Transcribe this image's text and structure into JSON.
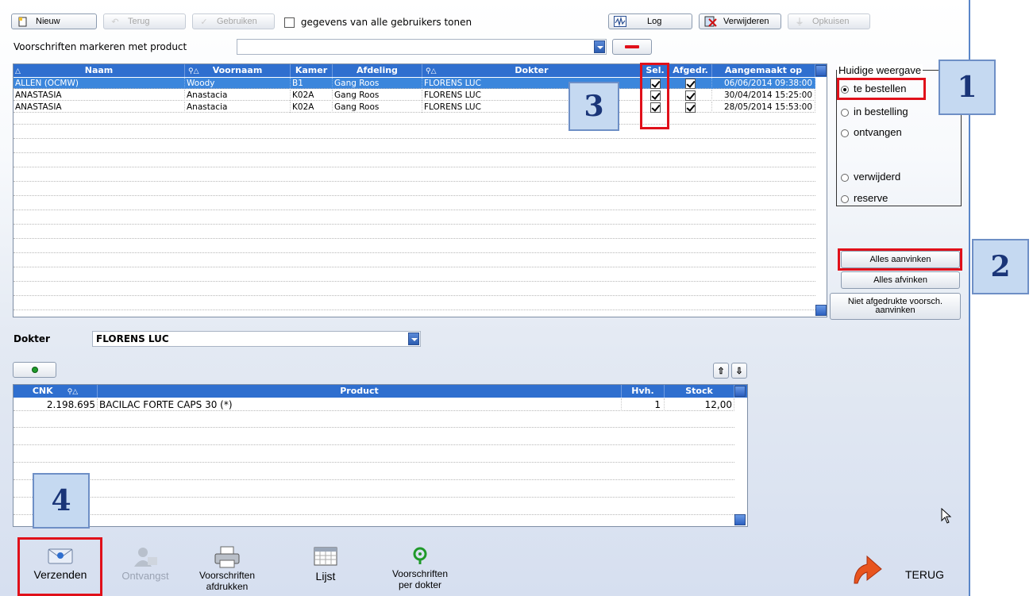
{
  "toolbar": {
    "new_label": "Nieuw",
    "back_label": "Terug",
    "use_label": "Gebruiken",
    "all_users_label": "gegevens van alle gebruikers tonen",
    "log_label": "Log",
    "delete_label": "Verwijderen",
    "cleanup_label": "Opkuisen"
  },
  "mark_label": "Voorschriften markeren met product",
  "prescriptions": {
    "headers": [
      "Naam",
      "Voornaam",
      "Kamer",
      "Afdeling",
      "Dokter",
      "Sel.",
      "Afgedr.",
      "Aangemaakt op"
    ],
    "rows": [
      {
        "naam": "ALLEN (OCMW)",
        "voornaam": "Woody",
        "kamer": "B1",
        "afdeling": "Gang Roos",
        "dokter": "FLORENS LUC",
        "sel": true,
        "afgedr": true,
        "aangemaakt": "06/06/2014 09:38:00"
      },
      {
        "naam": "ANASTASIA",
        "voornaam": "Anastacia",
        "kamer": "K02A",
        "afdeling": "Gang Roos",
        "dokter": "FLORENS LUC",
        "sel": true,
        "afgedr": true,
        "aangemaakt": "30/04/2014 15:25:00"
      },
      {
        "naam": "ANASTASIA",
        "voornaam": "Anastacia",
        "kamer": "K02A",
        "afdeling": "Gang Roos",
        "dokter": "FLORENS LUC",
        "sel": true,
        "afgedr": true,
        "aangemaakt": "28/05/2014 15:53:00"
      }
    ]
  },
  "view_group": {
    "title": "Huidige weergave",
    "options": [
      "te bestellen",
      "in bestelling",
      "ontvangen",
      "verwijderd",
      "reserve"
    ],
    "selected": "te bestellen"
  },
  "side_buttons": {
    "check_all": "Alles aanvinken",
    "uncheck_all": "Alles afvinken",
    "check_unprinted": "Niet afgedrukte voorsch. aanvinken"
  },
  "doctor": {
    "label": "Dokter",
    "value": "FLORENS LUC"
  },
  "products": {
    "headers": [
      "CNK",
      "Product",
      "Hvh.",
      "Stock"
    ],
    "rows": [
      {
        "cnk": "2.198.695",
        "product": "BACILAC FORTE CAPS 30 (*)",
        "hvh": "1",
        "stock": "12,00"
      }
    ]
  },
  "bottom": {
    "send": "Verzenden",
    "receipt": "Ontvangst",
    "print": "Voorschriften afdrukken",
    "list": "Lijst",
    "per_doctor": "Voorschriften per dokter",
    "back": "TERUG"
  },
  "callouts": [
    "1",
    "2",
    "3",
    "4"
  ],
  "colors": {
    "header_blue": "#2f6fcf",
    "selected_row": "#3b86dc",
    "highlight_red": "#e0101a",
    "callout_fill": "#c5d9f1"
  }
}
